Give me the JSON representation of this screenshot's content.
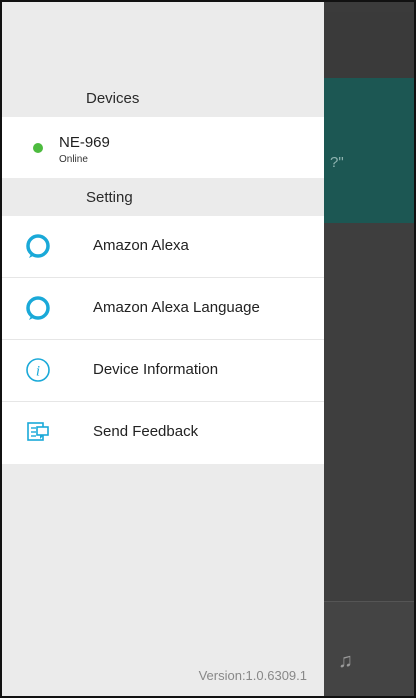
{
  "background": {
    "banner_text": "?\""
  },
  "drawer": {
    "devices_header": "Devices",
    "device": {
      "name": "NE-969",
      "status": "Online",
      "status_color": "#4dbb3f"
    },
    "setting_header": "Setting",
    "menu": [
      {
        "label": "Amazon Alexa",
        "icon": "alexa-icon"
      },
      {
        "label": "Amazon Alexa Language",
        "icon": "alexa-icon"
      },
      {
        "label": "Device Information",
        "icon": "info-icon"
      },
      {
        "label": "Send Feedback",
        "icon": "feedback-icon"
      }
    ],
    "version": "Version:1.0.6309.1"
  },
  "colors": {
    "accent": "#1aa9d8",
    "banner": "#1c5753"
  }
}
